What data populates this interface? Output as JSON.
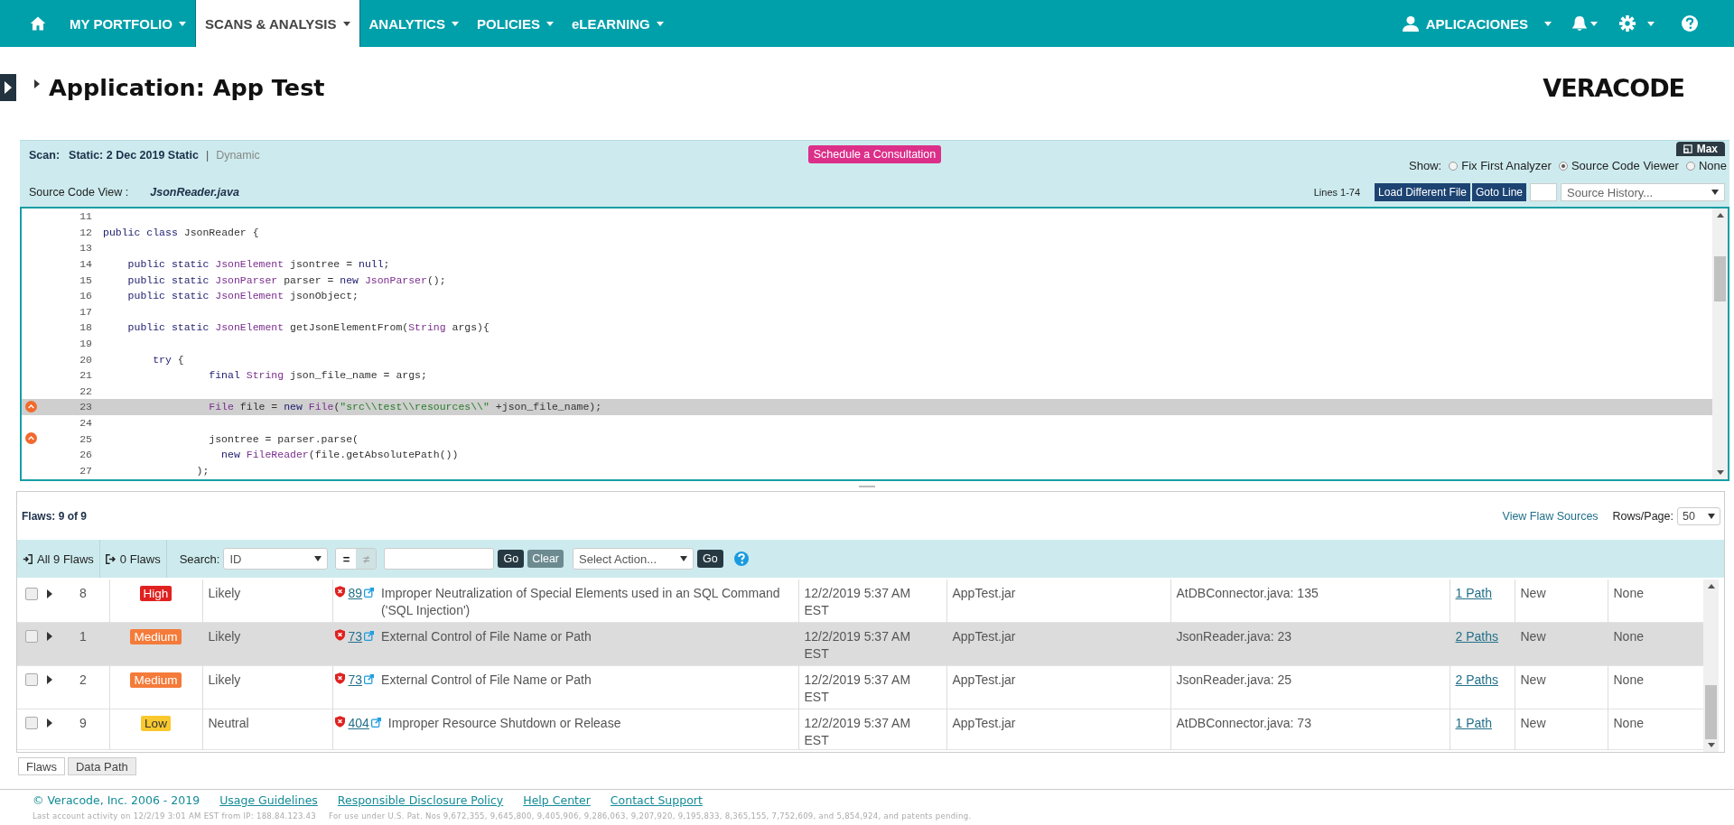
{
  "nav": {
    "items": [
      {
        "label": "MY PORTFOLIO",
        "selected": false
      },
      {
        "label": "SCANS & ANALYSIS",
        "selected": true
      },
      {
        "label": "ANALYTICS",
        "selected": false
      },
      {
        "label": "POLICIES",
        "selected": false
      },
      {
        "label": "eLEARNING",
        "selected": false
      }
    ],
    "user": "APLICACIONES"
  },
  "page": {
    "title": "Application: App Test",
    "logo": "VERACODE"
  },
  "scan": {
    "label": "Scan:",
    "static": "Static: 2 Dec 2019 Static",
    "separator": "|",
    "dynamic": "Dynamic",
    "consult_button": "Schedule a Consultation",
    "max_button": "Max",
    "show_label": "Show:",
    "show_options": [
      {
        "label": "Fix First Analyzer",
        "selected": false
      },
      {
        "label": "Source Code Viewer",
        "selected": true
      },
      {
        "label": "None",
        "selected": false
      }
    ],
    "source_label": "Source Code View :",
    "file_name": "JsonReader.java",
    "lines": "Lines 1-74",
    "load_button": "Load Different File",
    "goto_button": "Goto Line",
    "history_value": "Source History..."
  },
  "code": {
    "lines": [
      {
        "number": "11",
        "highlighted": false,
        "flaw_marker": false
      },
      {
        "number": "12",
        "highlighted": false,
        "flaw_marker": false,
        "tokens": [
          {
            "text": "public class",
            "kind": "keyword"
          },
          {
            "text": " JsonReader {",
            "kind": "plain"
          }
        ]
      },
      {
        "number": "13",
        "highlighted": false,
        "flaw_marker": false
      },
      {
        "number": "14",
        "highlighted": false,
        "flaw_marker": false,
        "tokens": [
          {
            "text": "    public static ",
            "kind": "keyword"
          },
          {
            "text": "JsonElement",
            "kind": "type"
          },
          {
            "text": " jsontree = ",
            "kind": "plain"
          },
          {
            "text": "null",
            "kind": "keyword"
          },
          {
            "text": ";",
            "kind": "plain"
          }
        ]
      },
      {
        "number": "15",
        "highlighted": false,
        "flaw_marker": false,
        "tokens": [
          {
            "text": "    public static ",
            "kind": "keyword"
          },
          {
            "text": "JsonParser",
            "kind": "type"
          },
          {
            "text": " parser = ",
            "kind": "plain"
          },
          {
            "text": "new ",
            "kind": "keyword"
          },
          {
            "text": "JsonParser",
            "kind": "type"
          },
          {
            "text": "();",
            "kind": "plain"
          }
        ]
      },
      {
        "number": "16",
        "highlighted": false,
        "flaw_marker": false,
        "tokens": [
          {
            "text": "    public static ",
            "kind": "keyword"
          },
          {
            "text": "JsonElement",
            "kind": "type"
          },
          {
            "text": " jsonObject;",
            "kind": "plain"
          }
        ]
      },
      {
        "number": "17",
        "highlighted": false,
        "flaw_marker": false
      },
      {
        "number": "18",
        "highlighted": false,
        "flaw_marker": false,
        "tokens": [
          {
            "text": "    public static ",
            "kind": "keyword"
          },
          {
            "text": "JsonElement",
            "kind": "type"
          },
          {
            "text": " getJsonElementFrom(",
            "kind": "plain"
          },
          {
            "text": "String",
            "kind": "type"
          },
          {
            "text": " args){",
            "kind": "plain"
          }
        ]
      },
      {
        "number": "19",
        "highlighted": false,
        "flaw_marker": false
      },
      {
        "number": "20",
        "highlighted": false,
        "flaw_marker": false,
        "tokens": [
          {
            "text": "        try",
            "kind": "keyword"
          },
          {
            "text": " {",
            "kind": "plain"
          }
        ]
      },
      {
        "number": "21",
        "highlighted": false,
        "flaw_marker": false,
        "tokens": [
          {
            "text": "                 final ",
            "kind": "keyword"
          },
          {
            "text": "String",
            "kind": "type"
          },
          {
            "text": " json_file_name = args;",
            "kind": "plain"
          }
        ]
      },
      {
        "number": "22",
        "highlighted": false,
        "flaw_marker": false
      },
      {
        "number": "23",
        "highlighted": true,
        "flaw_marker": true,
        "tokens": [
          {
            "text": "                 File",
            "kind": "type"
          },
          {
            "text": " file = ",
            "kind": "plain"
          },
          {
            "text": "new ",
            "kind": "keyword"
          },
          {
            "text": "File",
            "kind": "type"
          },
          {
            "text": "(",
            "kind": "plain"
          },
          {
            "text": "\"src\\\\test\\\\resources\\\\\"",
            "kind": "string"
          },
          {
            "text": " +json_file_name);",
            "kind": "plain"
          }
        ]
      },
      {
        "number": "24",
        "highlighted": false,
        "flaw_marker": false
      },
      {
        "number": "25",
        "highlighted": false,
        "flaw_marker": true,
        "tokens": [
          {
            "text": "                 jsontree = parser.parse(",
            "kind": "plain"
          }
        ]
      },
      {
        "number": "26",
        "highlighted": false,
        "flaw_marker": false,
        "tokens": [
          {
            "text": "                   new ",
            "kind": "keyword"
          },
          {
            "text": "FileReader",
            "kind": "type"
          },
          {
            "text": "(file.getAbsolutePath())",
            "kind": "plain"
          }
        ]
      },
      {
        "number": "27",
        "highlighted": false,
        "flaw_marker": false,
        "tokens": [
          {
            "text": "               );",
            "kind": "plain"
          }
        ]
      }
    ]
  },
  "flaws": {
    "count": "Flaws: 9 of 9",
    "sources_link": "View Flaw Sources",
    "rows_label": "Rows/Page:",
    "rows_value": "50",
    "filters": [
      {
        "label": "All 9 Flaws",
        "kind": "in"
      },
      {
        "label": "0 Flaws",
        "kind": "out"
      }
    ],
    "search_label": "Search:",
    "search_value": "ID",
    "operators": [
      {
        "label": "=",
        "selected": true
      },
      {
        "label": "≠",
        "selected": false
      }
    ],
    "go_button": "Go",
    "clear_button": "Clear",
    "action_value": "Select Action...",
    "action_go_button": "Go",
    "rows": [
      {
        "selected": false,
        "checked": false,
        "id": "8",
        "severity": "High",
        "color": "#e0211f",
        "exploitability": "Likely",
        "cwe": "89",
        "description": "Improper Neutralization of Special Elements used in an SQL Command ('SQL Injection')",
        "date": "12/2/2019 5:37 AM EST",
        "module": "AppTest.jar",
        "source": "AtDBConnector.java: 135",
        "paths": "1 Path",
        "status": "New",
        "mitigation": "None"
      },
      {
        "selected": true,
        "checked": false,
        "id": "1",
        "severity": "Medium",
        "color": "#f47b3a",
        "exploitability": "Likely",
        "cwe": "73",
        "description": "External Control of File Name or Path",
        "date": "12/2/2019 5:37 AM EST",
        "module": "AppTest.jar",
        "source": "JsonReader.java: 23",
        "paths": "2 Paths",
        "status": "New",
        "mitigation": "None"
      },
      {
        "selected": false,
        "checked": false,
        "id": "2",
        "severity": "Medium",
        "color": "#f47b3a",
        "exploitability": "Likely",
        "cwe": "73",
        "description": "External Control of File Name or Path",
        "date": "12/2/2019 5:37 AM EST",
        "module": "AppTest.jar",
        "source": "JsonReader.java: 25",
        "paths": "2 Paths",
        "status": "New",
        "mitigation": "None"
      },
      {
        "selected": false,
        "checked": false,
        "id": "9",
        "severity": "Low",
        "color": "#f8c82e",
        "exploitability": "Neutral",
        "cwe": "404",
        "description": "Improper Resource Shutdown or Release",
        "date": "12/2/2019 5:37 AM EST",
        "module": "AppTest.jar",
        "source": "AtDBConnector.java: 73",
        "paths": "1 Path",
        "status": "New",
        "mitigation": "None"
      }
    ]
  },
  "bottom_tabs": [
    {
      "label": "Flaws",
      "selected": true
    },
    {
      "label": "Data Path",
      "selected": false
    }
  ],
  "footer": {
    "copyright": "© Veracode, Inc. 2006 - 2019",
    "links": [
      "Usage Guidelines",
      "Responsible Disclosure Policy",
      "Help Center",
      "Contact Support"
    ],
    "activity": "Last account activity on 12/2/19 3:01 AM EST from IP: 188.84.123.43",
    "patents": "For use under U.S. Pat. Nos 9,672,355, 9,645,800, 9,405,906, 9,286,063, 9,207,920, 9,195,833, 8,365,155, 7,752,609, and 5,854,924, and patents pending."
  }
}
